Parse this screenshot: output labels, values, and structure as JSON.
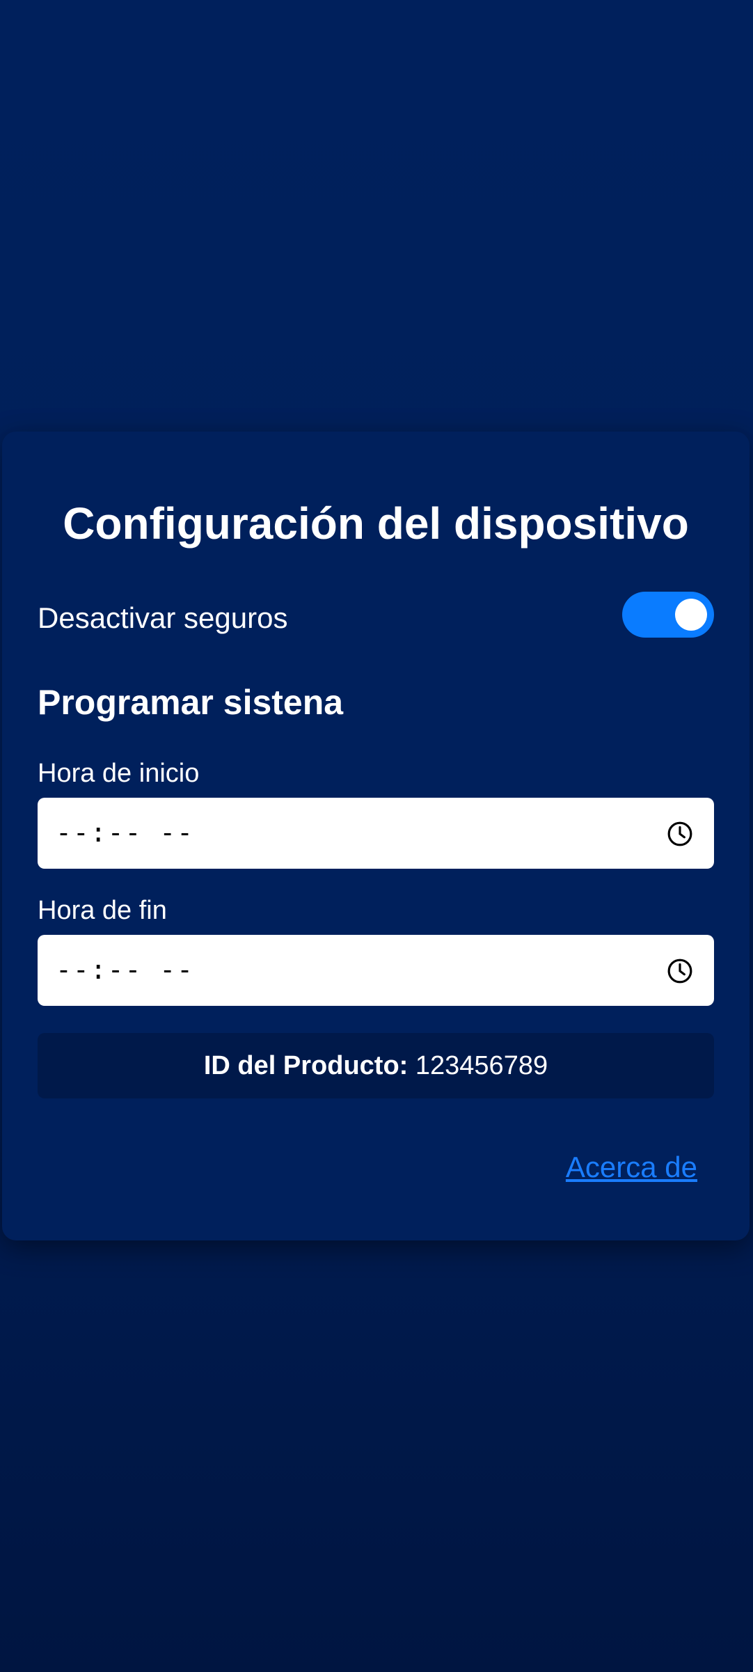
{
  "settings": {
    "title": "Configuración del dispositivo",
    "toggle_label": "Desactivar seguros",
    "toggle_on": true,
    "schedule_title": "Programar sistena",
    "start_label": "Hora de inicio",
    "start_value": "--:-- --",
    "end_label": "Hora de fin",
    "end_value": "--:-- --",
    "product_id_label": "ID del Producto:",
    "product_id_value": "123456789",
    "about_link": "Acerca de"
  },
  "colors": {
    "background": "#00205c",
    "accent": "#0a7cff",
    "link": "#1a7dff",
    "id_box": "#00194a"
  },
  "icons": {
    "start_icon": "clock-icon",
    "end_icon": "clock-icon"
  }
}
